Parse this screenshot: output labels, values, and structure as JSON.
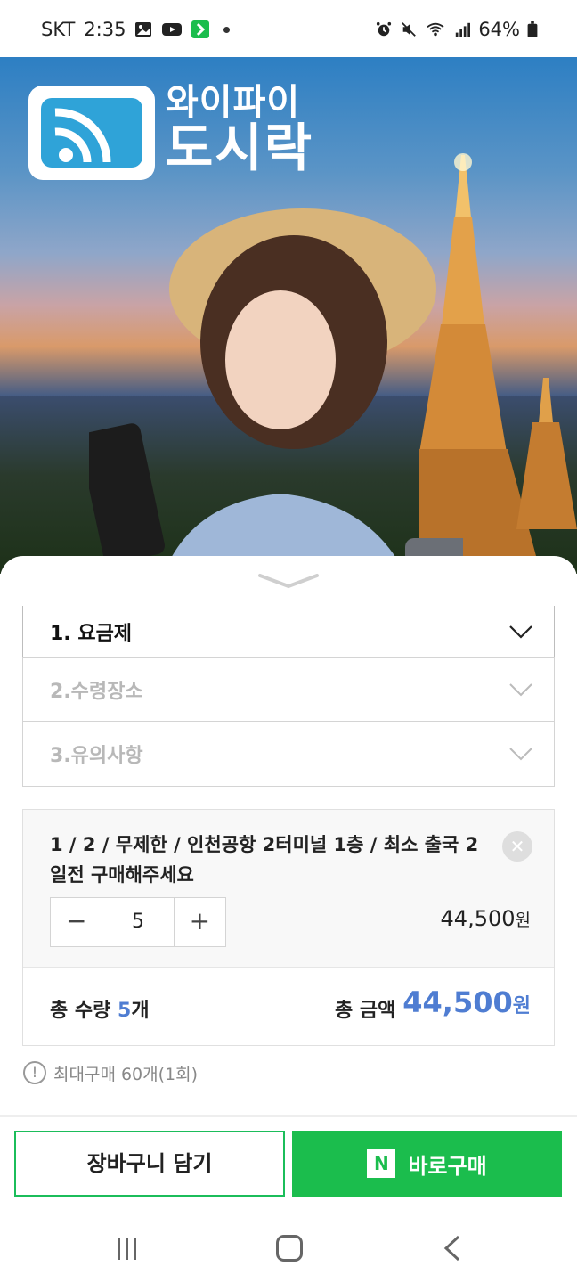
{
  "status_bar": {
    "carrier": "SKT",
    "time": "2:35",
    "battery": "64%",
    "icons": [
      "gallery-icon",
      "youtube-icon",
      "app-icon",
      "alarm-icon",
      "mute-icon",
      "wifi-icon",
      "signal-icon",
      "battery-icon"
    ]
  },
  "hero": {
    "logo_line1": "와이파이",
    "logo_line2": "도시락"
  },
  "accordion": {
    "items": [
      {
        "label": "1. 요금제",
        "state": "active"
      },
      {
        "label": "2.수령장소",
        "state": "dim"
      },
      {
        "label": "3.유의사항",
        "state": "dim"
      }
    ]
  },
  "option": {
    "title": "1 / 2 / 무제한 / 인천공항 2터미널 1층 / 최소 출국 2일전 구매해주세요",
    "quantity": "5",
    "minus": "−",
    "plus": "+",
    "price": "44,500",
    "price_unit": "원"
  },
  "total": {
    "qty_label": "총 수량 ",
    "qty_value": "5",
    "qty_unit": "개",
    "amount_label": "총 금액",
    "amount_value": "44,500",
    "amount_unit": "원"
  },
  "notice": {
    "icon": "!",
    "text": "최대구매 60개(1회)"
  },
  "buttons": {
    "cart": "장바구니 담기",
    "buy_logo": "N",
    "buy": "바로구매"
  },
  "colors": {
    "green": "#1bbd4d",
    "blue": "#4f7dd2"
  }
}
